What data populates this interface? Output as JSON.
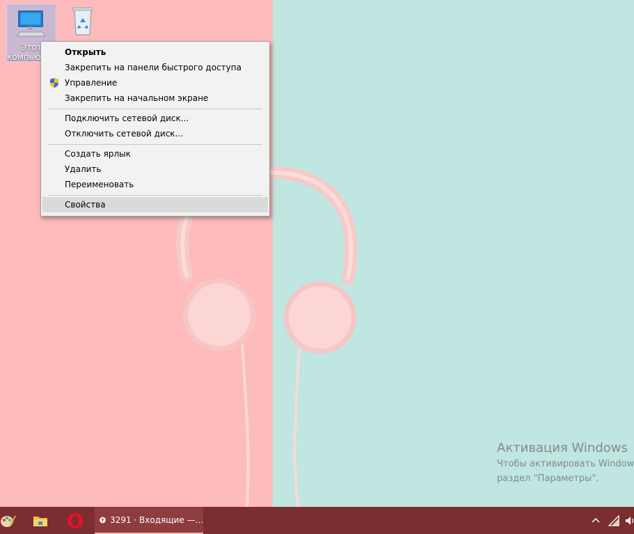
{
  "desktop": {
    "icons": [
      {
        "label_line1": "Этот",
        "label_line2": "компьютер",
        "icon": "computer-icon"
      },
      {
        "label_line1": "",
        "label_line2": "",
        "icon": "recycle-bin-icon"
      }
    ]
  },
  "context_menu": {
    "items": [
      {
        "label": "Открыть"
      },
      {
        "label": "Закрепить на панели быстрого доступа"
      },
      {
        "label": "Управление",
        "icon": "uac-shield-icon"
      },
      {
        "label": "Закрепить на начальном экране"
      },
      {
        "label": "Подключить сетевой диск..."
      },
      {
        "label": "Отключить сетевой диск..."
      },
      {
        "label": "Создать ярлык"
      },
      {
        "label": "Удалить"
      },
      {
        "label": "Переименовать"
      },
      {
        "label": "Свойства"
      }
    ]
  },
  "activation": {
    "title": "Активация Windows",
    "line1": "Чтобы активировать Windows",
    "line2": "раздел \"Параметры\"."
  },
  "taskbar": {
    "pinned": [
      "paint-icon",
      "file-explorer-icon",
      "opera-icon"
    ],
    "yandex_task": {
      "icon": "yandex-browser-icon",
      "title": "3291 · Входящие —..."
    },
    "tray": [
      "chevron-up-icon",
      "wifi-icon",
      "volume-icon"
    ]
  },
  "colors": {
    "wall_left": "#fdbcbb",
    "wall_right": "#bfe6e0",
    "taskbar": "#7b2e2f",
    "menu_bg": "#f2f2f2",
    "menu_highlight": "#dadada"
  }
}
